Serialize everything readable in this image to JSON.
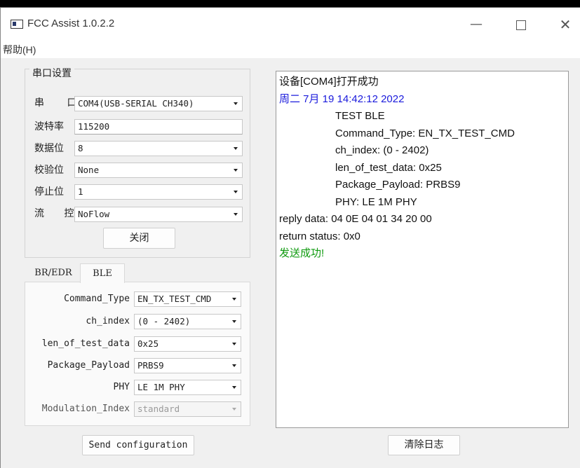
{
  "window": {
    "title": "FCC Assist 1.0.2.2",
    "controls": {
      "minimize": "—",
      "close": "✕"
    }
  },
  "menu": {
    "help": "帮助(H)"
  },
  "serial": {
    "group_title": "串口设置",
    "port_label": "串 口",
    "port_value": "COM4(USB-SERIAL CH340)",
    "baud_label": "波特率",
    "baud_value": "115200",
    "databits_label": "数据位",
    "databits_value": "8",
    "parity_label": "校验位",
    "parity_value": "None",
    "stopbits_label": "停止位",
    "stopbits_value": "1",
    "flow_label": "流 控",
    "flow_value": "NoFlow",
    "close_button": "关闭"
  },
  "tabs": {
    "bredr": "BR/EDR",
    "ble": "BLE",
    "active": "BLE"
  },
  "ble": {
    "command_type_label": "Command_Type",
    "command_type_value": "EN_TX_TEST_CMD",
    "ch_index_label": "ch_index",
    "ch_index_value": "(0 - 2402)",
    "len_label": "len_of_test_data",
    "len_value": "0x25",
    "payload_label": "Package_Payload",
    "payload_value": "PRBS9",
    "phy_label": "PHY",
    "phy_value": "LE 1M PHY",
    "modulation_label": "Modulation_Index",
    "modulation_value": "standard",
    "send_button": "Send configuration"
  },
  "log": {
    "lines": [
      {
        "text": "设备[COM4]打开成功",
        "style": "normal"
      },
      {
        "text": "周二 7月 19 14:42:12 2022",
        "style": "blue"
      },
      {
        "text": "TEST BLE",
        "style": "indent"
      },
      {
        "text": "Command_Type: EN_TX_TEST_CMD",
        "style": "indent"
      },
      {
        "text": "ch_index: (0 - 2402)",
        "style": "indent"
      },
      {
        "text": "len_of_test_data: 0x25",
        "style": "indent"
      },
      {
        "text": "Package_Payload: PRBS9",
        "style": "indent"
      },
      {
        "text": "PHY: LE 1M PHY",
        "style": "indent"
      },
      {
        "text": "reply data: 04 0E 04 01 34 20 00",
        "style": "normal"
      },
      {
        "text": "return status: 0x0",
        "style": "normal"
      },
      {
        "text": "发送成功!",
        "style": "green"
      }
    ],
    "clear_button": "清除日志"
  },
  "colors": {
    "log_timestamp": "#1a1adc",
    "log_success": "#0e9a0e"
  }
}
